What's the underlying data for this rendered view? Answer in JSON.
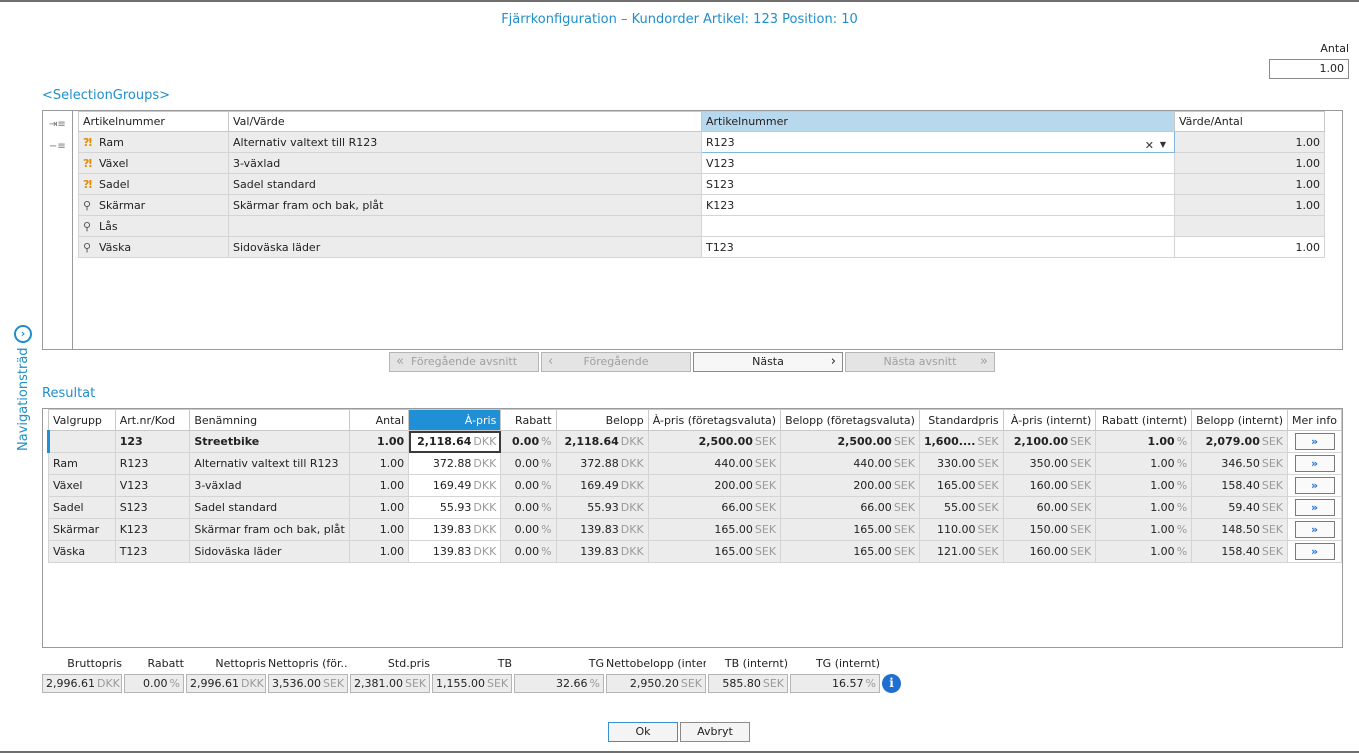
{
  "window": {
    "title": "Fjärrkonfiguration – Kundorder Artikel: 123 Position: 10"
  },
  "quantity": {
    "label": "Antal",
    "value": "1.00"
  },
  "navigation_tree": {
    "label": "Navigationsträd",
    "icon": "chevron-right-circle-icon"
  },
  "selection_groups": {
    "heading": "<SelectionGroups>",
    "columns": [
      "Artikelnummer",
      "Val/Värde",
      "Artikelnummer",
      "Värde/Antal"
    ],
    "rows": [
      {
        "icon": "warning-icon",
        "group": "Ram",
        "value": "Alternativ valtext till R123",
        "article": "R123",
        "qty": "1.00"
      },
      {
        "icon": "warning-icon",
        "group": "Växel",
        "value": "3-växlad",
        "article": "V123",
        "qty": "1.00"
      },
      {
        "icon": "warning-icon",
        "group": "Sadel",
        "value": "Sadel standard",
        "article": "S123",
        "qty": "1.00"
      },
      {
        "icon": "search-icon",
        "group": "Skärmar",
        "value": "Skärmar fram och bak, plåt",
        "article": "K123",
        "qty": "1.00"
      },
      {
        "icon": "search-icon",
        "group": "Lås",
        "value": "",
        "article": "",
        "qty": ""
      },
      {
        "icon": "search-icon",
        "group": "Väska",
        "value": "Sidoväska läder",
        "article": "T123",
        "qty": "1.00"
      }
    ]
  },
  "nav_buttons": {
    "prev_section": "Föregående avsnitt",
    "prev": "Föregående",
    "next": "Nästa",
    "next_section": "Nästa avsnitt"
  },
  "result": {
    "heading": "Resultat",
    "columns": [
      "Valgrupp",
      "Art.nr/Kod",
      "Benämning",
      "Antal",
      "À-pris",
      "Rabatt",
      "Belopp",
      "À-pris (företagsvaluta)",
      "Belopp (företagsvaluta)",
      "Standardpris",
      "À-pris (internt)",
      "Rabatt (internt)",
      "Belopp (internt)",
      "Mer info"
    ],
    "currency_local": "DKK",
    "currency_company": "SEK",
    "percent": "%",
    "more_icon": "double-chevron-right-icon",
    "rows": [
      {
        "group": "",
        "code": "123",
        "name": "Streetbike",
        "qty": "1.00",
        "price": "2,118.64",
        "discount": "0.00",
        "amount": "2,118.64",
        "price_company": "2,500.00",
        "amount_company": "2,500.00",
        "std_price": "1,600....",
        "price_internal": "2,100.00",
        "discount_internal": "1.00",
        "amount_internal": "2,079.00"
      },
      {
        "group": "Ram",
        "code": "R123",
        "name": "Alternativ valtext till R123",
        "qty": "1.00",
        "price": "372.88",
        "discount": "0.00",
        "amount": "372.88",
        "price_company": "440.00",
        "amount_company": "440.00",
        "std_price": "330.00",
        "price_internal": "350.00",
        "discount_internal": "1.00",
        "amount_internal": "346.50"
      },
      {
        "group": "Växel",
        "code": "V123",
        "name": "3-växlad",
        "qty": "1.00",
        "price": "169.49",
        "discount": "0.00",
        "amount": "169.49",
        "price_company": "200.00",
        "amount_company": "200.00",
        "std_price": "165.00",
        "price_internal": "160.00",
        "discount_internal": "1.00",
        "amount_internal": "158.40"
      },
      {
        "group": "Sadel",
        "code": "S123",
        "name": "Sadel standard",
        "qty": "1.00",
        "price": "55.93",
        "discount": "0.00",
        "amount": "55.93",
        "price_company": "66.00",
        "amount_company": "66.00",
        "std_price": "55.00",
        "price_internal": "60.00",
        "discount_internal": "1.00",
        "amount_internal": "59.40"
      },
      {
        "group": "Skärmar",
        "code": "K123",
        "name": "Skärmar fram och bak, plåt",
        "qty": "1.00",
        "price": "139.83",
        "discount": "0.00",
        "amount": "139.83",
        "price_company": "165.00",
        "amount_company": "165.00",
        "std_price": "110.00",
        "price_internal": "150.00",
        "discount_internal": "1.00",
        "amount_internal": "148.50"
      },
      {
        "group": "Väska",
        "code": "T123",
        "name": "Sidoväska läder",
        "qty": "1.00",
        "price": "139.83",
        "discount": "0.00",
        "amount": "139.83",
        "price_company": "165.00",
        "amount_company": "165.00",
        "std_price": "121.00",
        "price_internal": "160.00",
        "discount_internal": "1.00",
        "amount_internal": "158.40"
      }
    ]
  },
  "totals": {
    "gross_label": "Bruttopris",
    "gross": "2,996.61",
    "discount_label": "Rabatt",
    "discount": "0.00",
    "net_label": "Nettopris",
    "net": "2,996.61",
    "net_company_label": "Nettopris (för...",
    "net_company": "3,536.00",
    "std_label": "Std.pris",
    "std": "2,381.00",
    "tb_label": "TB",
    "tb": "1,155.00",
    "tg_label": "TG",
    "tg": "32.66",
    "net_amount_internal_label": "Nettobelopp (inter...",
    "net_amount_internal": "2,950.20",
    "tb_internal_label": "TB (internt)",
    "tb_internal": "585.80",
    "tg_internal_label": "TG (internt)",
    "tg_internal": "16.57",
    "info_icon": "info-icon"
  },
  "dialog": {
    "ok": "Ok",
    "cancel": "Avbryt"
  }
}
